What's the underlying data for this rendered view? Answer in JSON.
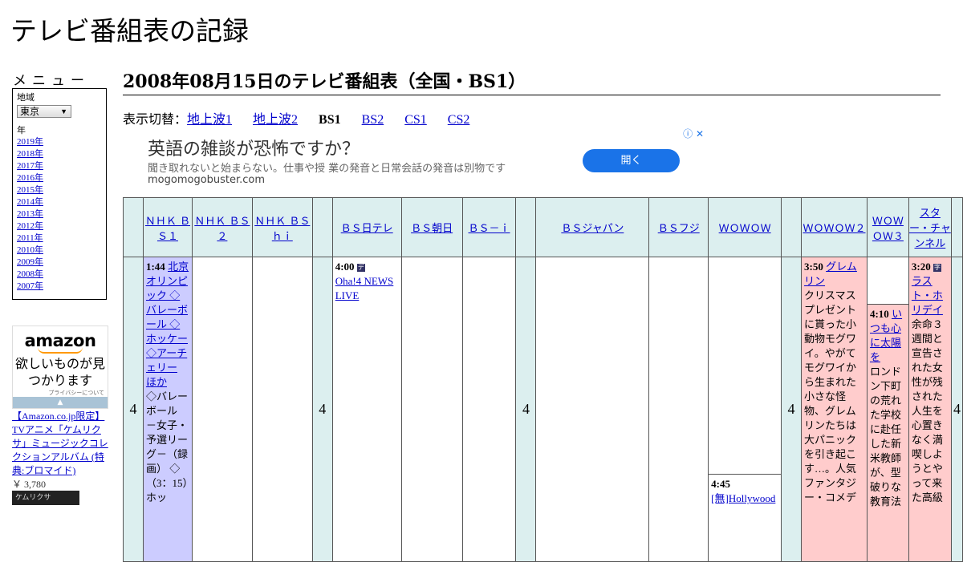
{
  "site_title": "テレビ番組表の記録",
  "menu": {
    "heading": "メニュー",
    "region_label": "地域",
    "region_value": "東京",
    "year_label": "年",
    "years": [
      "2019年",
      "2018年",
      "2017年",
      "2016年",
      "2015年",
      "2014年",
      "2013年",
      "2012年",
      "2011年",
      "2010年",
      "2009年",
      "2008年",
      "2007年"
    ]
  },
  "amazon_ad": {
    "logo": "amazon",
    "message": "欲しいものが見つかります",
    "privacy": "プライバシーについて"
  },
  "promo": {
    "text": "【Amazon.co.jp限定】TVアニメ「ケムリクサ」ミュージックコレクションアルバム (特典:ブロマイド)",
    "price": "￥ 3,780",
    "image_text": "ケムリクサ"
  },
  "page_title": "2008年08月15日のテレビ番組表（全国・BS1）",
  "switcher": {
    "lead": "表示切替：",
    "links": [
      "地上波1",
      "地上波2"
    ],
    "current": "BS1",
    "others": [
      "BS2",
      "CS1",
      "CS2"
    ]
  },
  "banner_ad": {
    "headline": "英語の雑談が恐怖ですか？",
    "sub": "聞き取れないと始まらない。仕事や授 業の発音と日常会話の発音は別物です",
    "domain": "mogomogobuster.com",
    "button": "開く",
    "icons": "ⓘ ✕"
  },
  "channels": [
    "ＮＨＫ ＢＳ１",
    "ＮＨＫ ＢＳ２",
    "ＮＨＫ ＢＳｈｉ",
    "ＢＳ日テレ",
    "ＢＳ朝日",
    "ＢＳ－ｉ",
    "ＢＳジャパン",
    "ＢＳフジ",
    "ＷＯＷＯＷ",
    "ＷＯＷＯＷ２",
    "ＷＯＷＯＷ３",
    "スター・チャンネル"
  ],
  "hour": "4",
  "programs": {
    "bs1": {
      "time": "1:44",
      "title": "北京オリンピック ◇バレーボール ◇ホッケー ◇アーチェリー ほか",
      "desc": "◇バレーボール －女子・予選リーグ－（録画） ◇（3：15）ホッ"
    },
    "bsntv": {
      "time": "4:00",
      "title": "Oha!4 NEWS LIVE"
    },
    "wowow_b": {
      "time": "4:45",
      "title": "[無]Hollywood"
    },
    "wowow2": {
      "time": "3:50",
      "title": "グレムリン",
      "desc": "クリスマスプレゼントに貰った小動物モグワイ。やがてモグワイから生まれた小さな怪物、グレムリンたちは大パニックを引き起こす…。人気ファンタジー・コメデ"
    },
    "wowow3": {
      "time": "4:10",
      "title": "いつも心に太陽を",
      "desc": "ロンドン下町の荒れた学校に赴任した新米教師が、型破りな教育法"
    },
    "star": {
      "time": "3:20",
      "title": "ラスト・ホリデイ",
      "desc": "余命３週間と宣告された女性が残された人生を心置きなく満喫しようとやって来た高級"
    }
  }
}
